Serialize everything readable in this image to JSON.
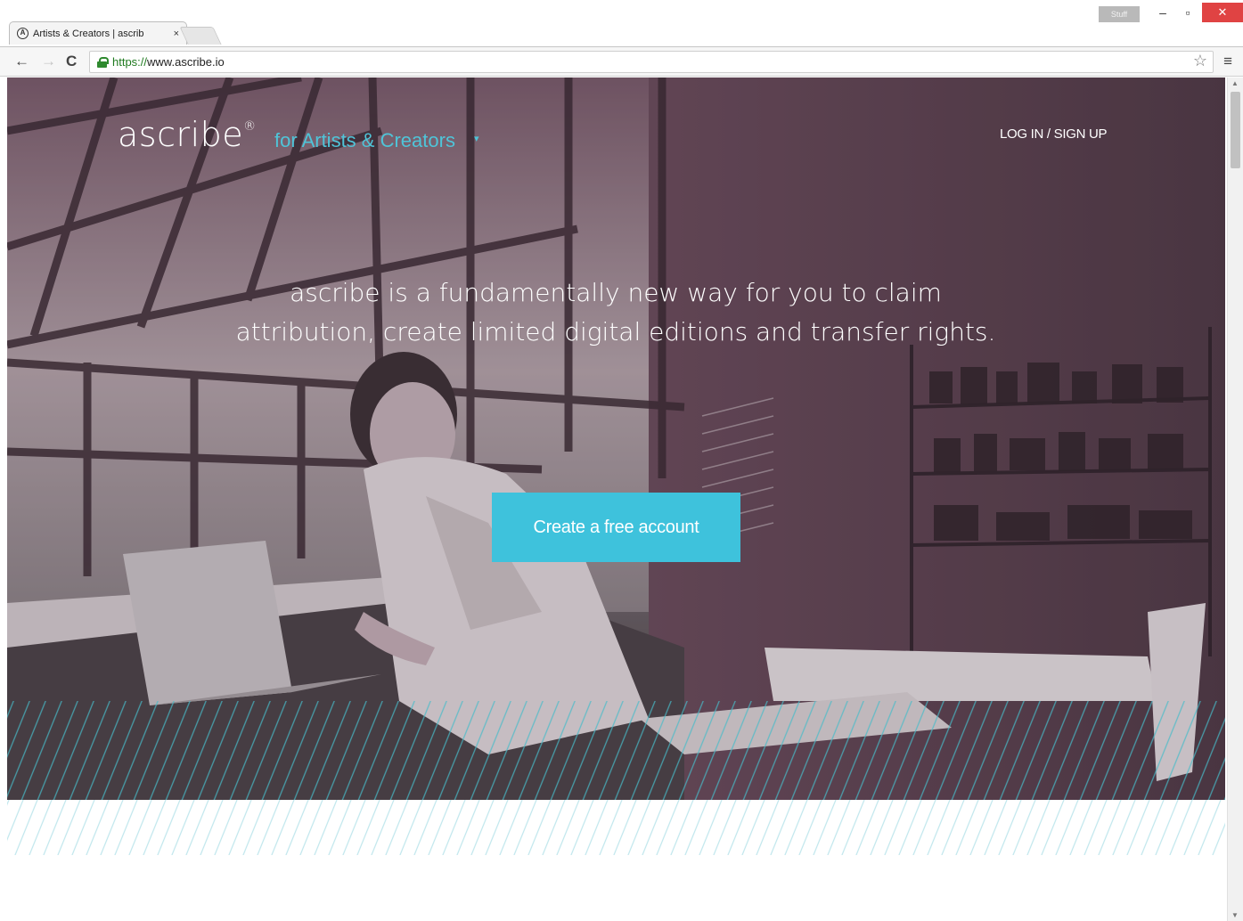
{
  "browser": {
    "tab_title": "Artists & Creators | ascrib",
    "tab_favicon": "ascribe-favicon",
    "tab_close": "×",
    "user_badge": "Stuff",
    "window_controls": {
      "minimize": "–",
      "maximize": "▫",
      "close": "✕"
    },
    "nav": {
      "back": "←",
      "forward": "→",
      "reload": "C"
    },
    "url_scheme": "https://",
    "url_rest": "www.ascribe.io",
    "bookmark_star": "☆",
    "menu": "≡",
    "colors": {
      "secure_green": "#2f8a2f",
      "close_red": "#e04343"
    }
  },
  "header": {
    "logo": "ascribe",
    "logo_mark": "®",
    "product": "for Artists & Creators",
    "product_caret": "▾",
    "login": "LOG IN / SIGN UP"
  },
  "hero": {
    "tagline_line1": "ascribe is a fundamentally new way for you to claim",
    "tagline_line2": "attribution, create limited digital editions and transfer rights.",
    "cta": "Create a free account"
  },
  "colors": {
    "accent": "#3ec2dc",
    "product_link": "#4fc4d8",
    "hatch": "#47bcc9"
  }
}
